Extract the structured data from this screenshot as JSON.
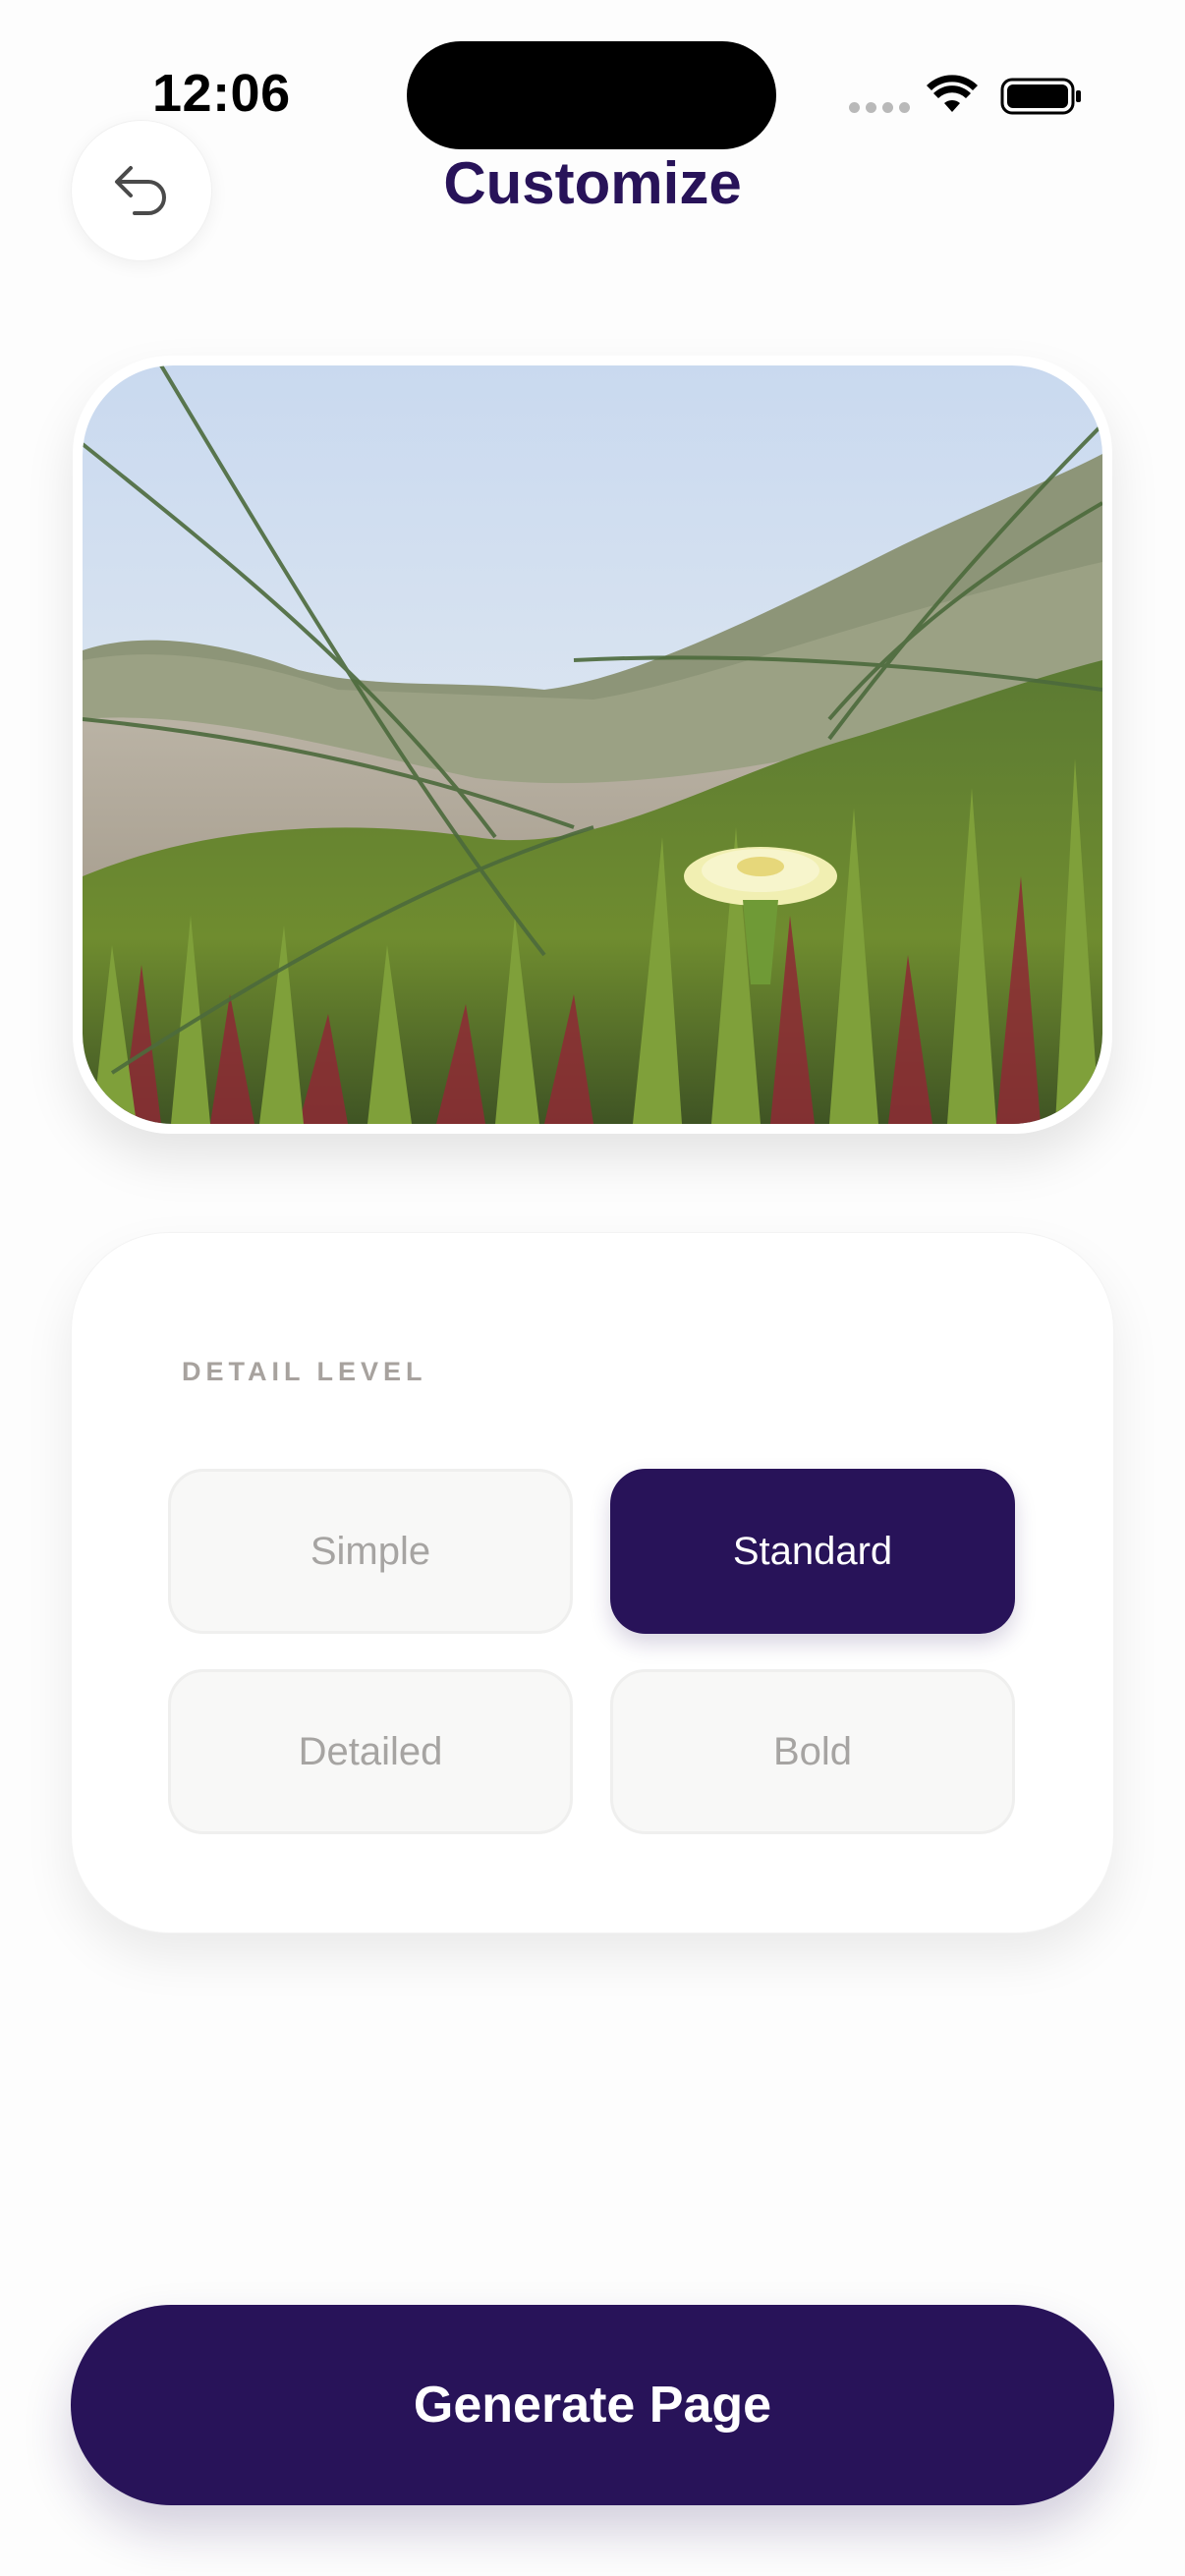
{
  "status_bar": {
    "time": "12:06"
  },
  "header": {
    "title": "Customize",
    "back_icon": "undo-arrow-icon"
  },
  "photo": {
    "description_icon": "photo-preview"
  },
  "detail": {
    "label": "DETAIL LEVEL",
    "options": [
      {
        "label": "Simple",
        "selected": false
      },
      {
        "label": "Standard",
        "selected": true
      },
      {
        "label": "Detailed",
        "selected": false
      },
      {
        "label": "Bold",
        "selected": false
      }
    ]
  },
  "actions": {
    "generate_label": "Generate Page"
  },
  "colors": {
    "accent": "#281359",
    "muted_text": "#a6a4a2",
    "option_bg": "#f8f8f7"
  }
}
